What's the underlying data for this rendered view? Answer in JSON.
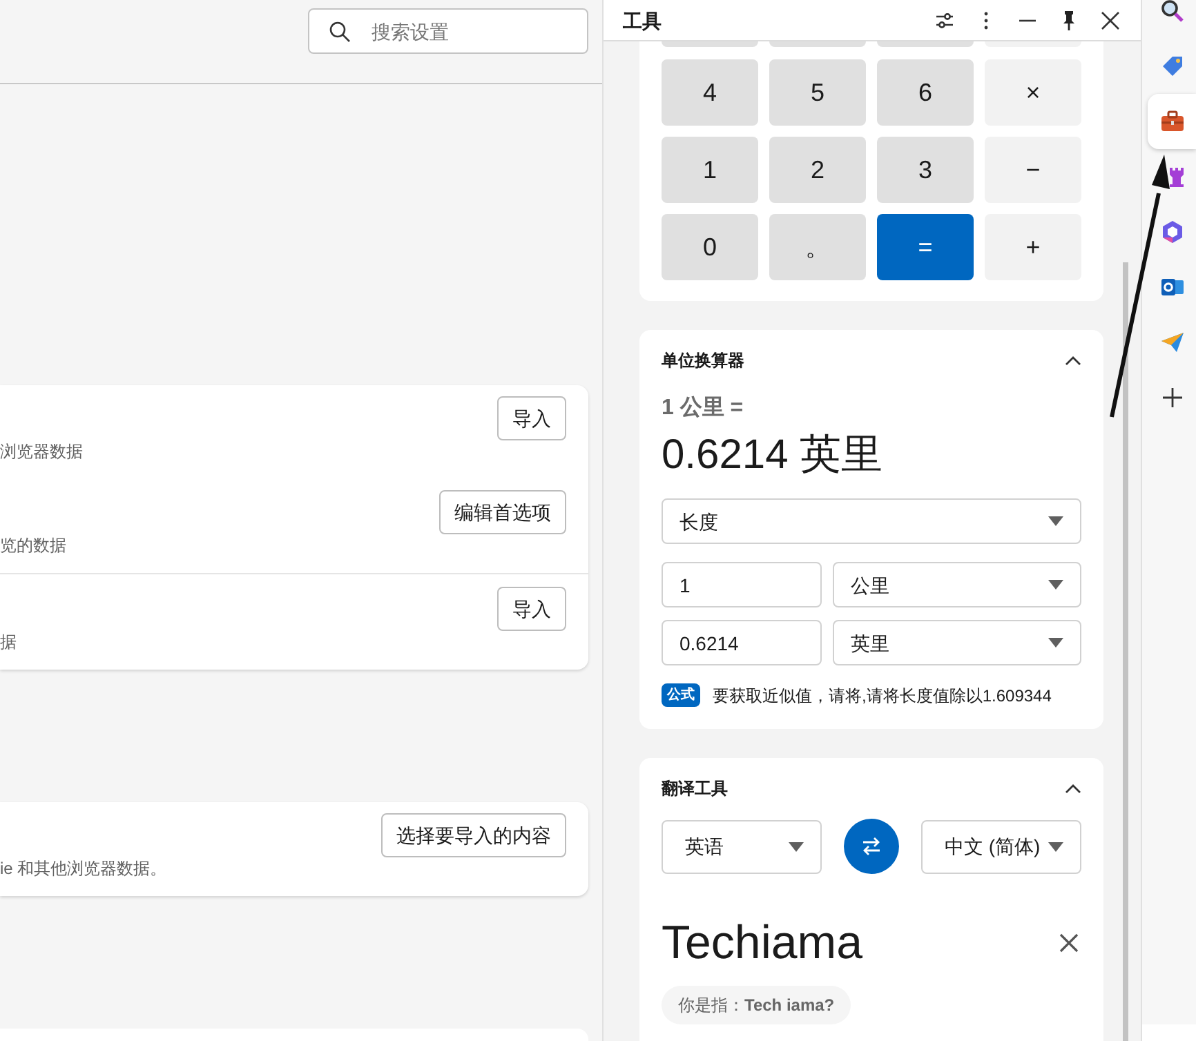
{
  "settings": {
    "search": {
      "placeholder": "搜索设置"
    },
    "cards": [
      {
        "rows": [
          {
            "description": "浏览器数据",
            "button": "导入"
          },
          {
            "description": "览的数据",
            "button": "编辑首选项"
          },
          {
            "description": "据",
            "button": "导入"
          }
        ]
      },
      {
        "rows": [
          {
            "description": "ie 和其他浏览器数据。",
            "button": "选择要导入的内容"
          }
        ]
      }
    ]
  },
  "tools_panel": {
    "title": "工具",
    "calculator": {
      "keys": [
        {
          "label": "4",
          "kind": "digit"
        },
        {
          "label": "5",
          "kind": "digit"
        },
        {
          "label": "6",
          "kind": "digit"
        },
        {
          "label": "×",
          "kind": "operator"
        },
        {
          "label": "1",
          "kind": "digit"
        },
        {
          "label": "2",
          "kind": "digit"
        },
        {
          "label": "3",
          "kind": "digit"
        },
        {
          "label": "−",
          "kind": "operator"
        },
        {
          "label": "0",
          "kind": "digit"
        },
        {
          "label": "。",
          "kind": "digit"
        },
        {
          "label": "=",
          "kind": "equals"
        },
        {
          "label": "+",
          "kind": "operator"
        }
      ]
    },
    "unit_converter": {
      "title": "单位换算器",
      "expanded": true,
      "summary": "1 公里 =",
      "result": "0.6214 英里",
      "category": "长度",
      "from_value": "1",
      "from_unit": "公里",
      "to_value": "0.6214",
      "to_unit": "英里",
      "formula_badge": "公式",
      "formula": "要获取近似值，请将,请将长度值除以1.609344"
    },
    "translator": {
      "title": "翻译工具",
      "expanded": true,
      "source_language": "英语",
      "target_language": "中文 (简体)",
      "input_text": "Techiama",
      "suggestion": "你是指：**Tech iama?**"
    }
  },
  "sidebar": {
    "items": [
      {
        "kind": "search",
        "selected": false
      },
      {
        "kind": "tag",
        "selected": false
      },
      {
        "kind": "toolbox",
        "selected": true
      },
      {
        "kind": "rook",
        "selected": false
      },
      {
        "kind": "copilot",
        "selected": false
      },
      {
        "kind": "mail",
        "selected": false
      },
      {
        "kind": "send",
        "selected": false
      },
      {
        "kind": "add",
        "selected": false
      }
    ]
  }
}
